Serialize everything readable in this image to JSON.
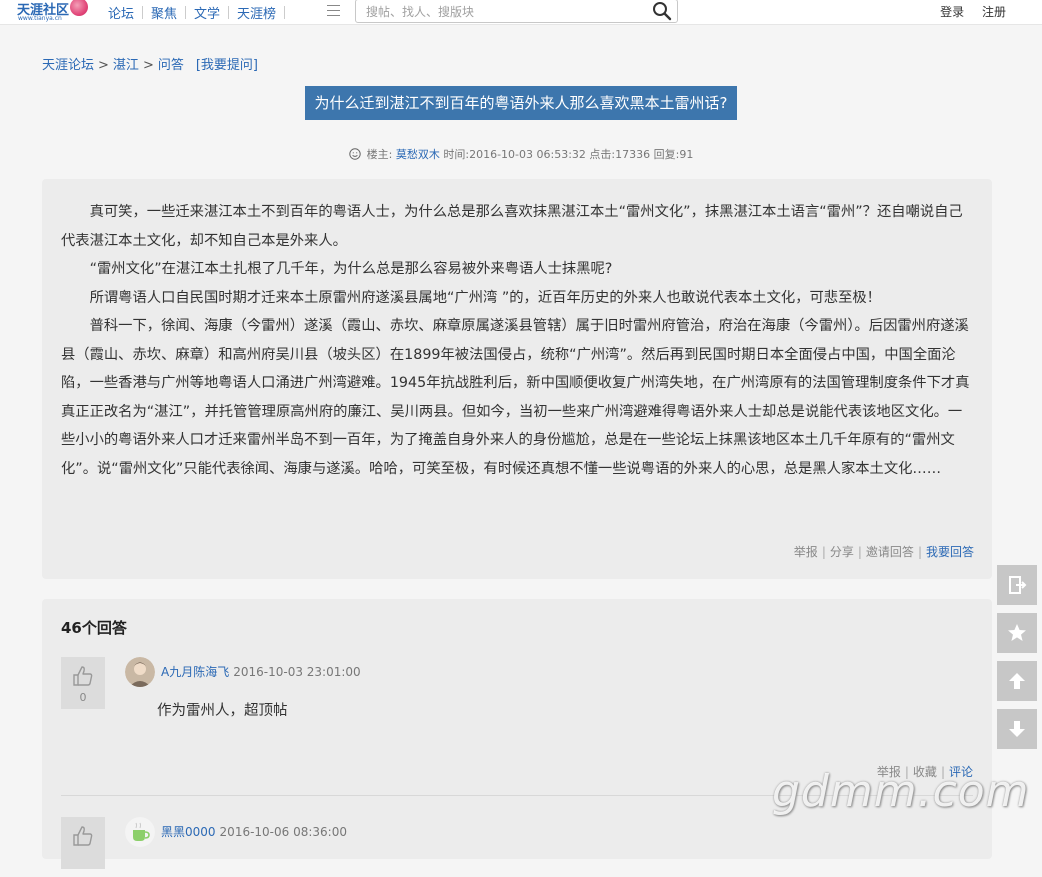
{
  "header": {
    "logo_text": "天涯社区",
    "logo_sub": "www.tianya.cn",
    "nav": [
      "论坛",
      "聚焦",
      "文学",
      "天涯榜"
    ],
    "search_placeholder": "搜帖、找人、搜版块",
    "login": "登录",
    "register": "注册"
  },
  "breadcrumb": {
    "items": [
      "天涯论坛",
      "湛江",
      "问答"
    ],
    "separator": ">",
    "ask_link": "[我要提问]"
  },
  "post": {
    "title": "为什么迁到湛江不到百年的粤语外来人那么喜欢黑本土雷州话?",
    "meta": {
      "author_label": "楼主:",
      "author": "莫愁双木",
      "time_label": "时间:",
      "time": "2016-10-03 06:53:32",
      "clicks_label": "点击:",
      "clicks": "17336",
      "replies_label": "回复:",
      "replies": "91"
    },
    "paragraphs": [
      "真可笑，一些迁来湛江本土不到百年的粤语人士，为什么总是那么喜欢抹黑湛江本土“雷州文化”，抹黑湛江本土语言“雷州”？还自嘲说自己代表湛江本土文化，却不知自己本是外来人。",
      "“雷州文化”在湛江本土扎根了几千年，为什么总是那么容易被外来粤语人士抹黑呢?",
      "所谓粤语人口自民国时期才迁来本土原雷州府遂溪县属地“广州湾 ”的，近百年历史的外来人也敢说代表本土文化，可悲至极！",
      "普科一下，徐闻、海康（今雷州）遂溪（霞山、赤坎、麻章原属遂溪县管辖）属于旧时雷州府管治，府治在海康（今雷州）。后因雷州府遂溪县（霞山、赤坎、麻章）和高州府吴川县（坡头区）在1899年被法国侵占，统称“广州湾”。然后再到民国时期日本全面侵占中国，中国全面沦陷，一些香港与广州等地粤语人口涌进广州湾避难。1945年抗战胜利后，新中国顺便收复广州湾失地，在广州湾原有的法国管理制度条件下才真真正正改名为“湛江”，并托管管理原高州府的廉江、吴川两县。但如今，当初一些来广州湾避难得粤语外来人士却总是说能代表该地区文化。一些小小的粤语外来人口才迁来雷州半岛不到一百年，为了掩盖自身外来人的身份尴尬，总是在一些论坛上抹黑该地区本土几千年原有的“雷州文化”。说“雷州文化”只能代表徐闻、海康与遂溪。哈哈，可笑至极，有时候还真想不懂一些说粤语的外来人的心思，总是黑人家本土文化……"
    ],
    "actions": [
      "举报",
      "分享",
      "邀请回答",
      "我要回答"
    ]
  },
  "answers": {
    "count_label": "46个回答",
    "items": [
      {
        "user": "A九月陈海飞",
        "time": "2016-10-03 23:01:00",
        "votes": "0",
        "text": "作为雷州人，超顶帖",
        "actions": [
          "举报",
          "收藏",
          "评论"
        ]
      },
      {
        "user": "黑黑0000",
        "time": "2016-10-06 08:36:00"
      }
    ]
  },
  "side_tools": [
    "exit-icon",
    "star-icon",
    "arrow-up-icon",
    "arrow-down-icon"
  ],
  "watermark": "gdmm.com",
  "colors": {
    "link": "#2b69b5",
    "title_bg": "#3d76ad",
    "panel_bg": "#ececec",
    "page_bg": "#f5f5f5"
  }
}
